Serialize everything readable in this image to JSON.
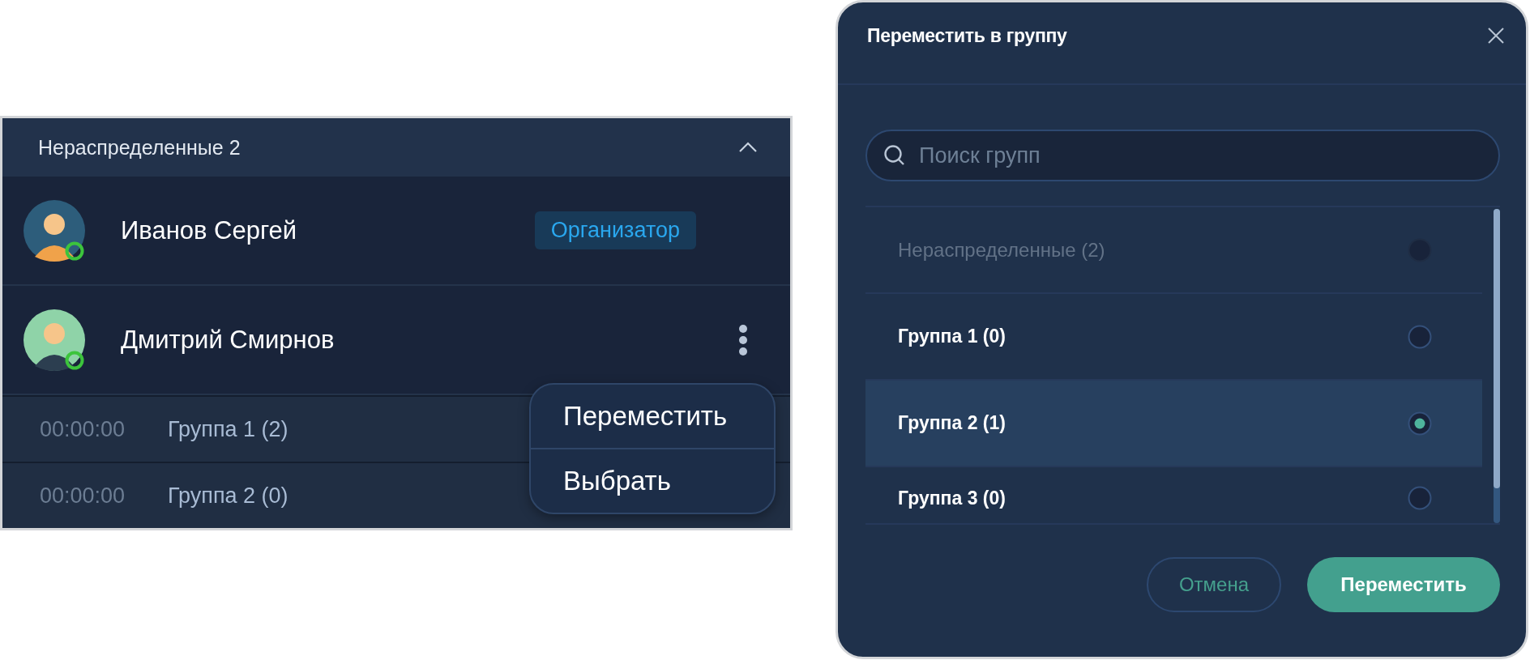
{
  "panel": {
    "title": "Нераспределенные 2",
    "expanded": true,
    "members": [
      {
        "name": "Иванов Сергей",
        "online": true,
        "badge": "Организатор"
      },
      {
        "name": "Дмитрий Смирнов",
        "online": true,
        "menu": true
      }
    ],
    "groups": [
      {
        "time": "00:00:00",
        "label": "Группа 1 (2)"
      },
      {
        "time": "00:00:00",
        "label": "Группа 2 (0)"
      }
    ],
    "context_menu": {
      "items": [
        "Переместить",
        "Выбрать"
      ]
    }
  },
  "dialog": {
    "title": "Переместить в группу",
    "search": {
      "placeholder": "Поиск групп"
    },
    "options": [
      {
        "label": "Нераспределенные (2)",
        "selected": false,
        "disabled": true
      },
      {
        "label": "Группа 1 (0)",
        "selected": false,
        "disabled": false
      },
      {
        "label": "Группа 2 (1)",
        "selected": true,
        "disabled": false
      },
      {
        "label": "Группа 3 (0)",
        "selected": false,
        "disabled": false
      }
    ],
    "buttons": {
      "cancel": "Отмена",
      "confirm": "Переместить"
    }
  }
}
